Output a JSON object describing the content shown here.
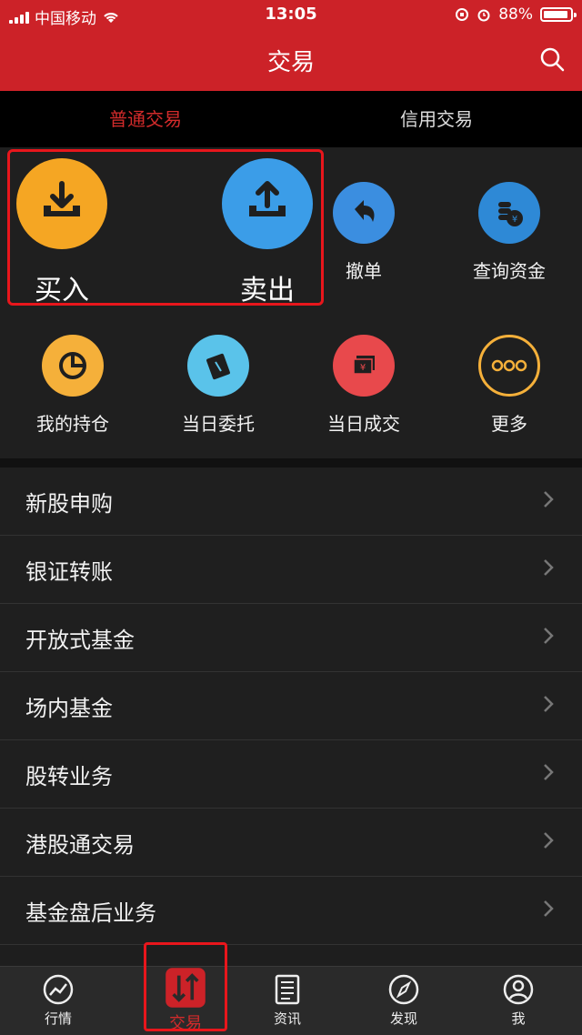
{
  "status": {
    "carrier": "中国移动",
    "time": "13:05",
    "battery": "88%"
  },
  "header": {
    "title": "交易"
  },
  "tabs": [
    {
      "label": "普通交易",
      "active": true
    },
    {
      "label": "信用交易",
      "active": false
    }
  ],
  "grid": {
    "buy": "买入",
    "sell": "卖出",
    "cancel": "撤单",
    "funds": "查询资金",
    "positions": "我的持仓",
    "orders": "当日委托",
    "deals": "当日成交",
    "more": "更多"
  },
  "list": [
    "新股申购",
    "银证转账",
    "开放式基金",
    "场内基金",
    "股转业务",
    "港股通交易",
    "基金盘后业务"
  ],
  "tabbar": {
    "market": "行情",
    "trade": "交易",
    "news": "资讯",
    "discover": "发现",
    "me": "我"
  },
  "colors": {
    "accent": "#cc2228",
    "buy": "#f5a623",
    "sell": "#3b9de8",
    "cancel": "#3b8ee0",
    "funds": "#2e89d6",
    "positions": "#f5b03a",
    "orders": "#5ac3ea",
    "deals": "#e8494c",
    "more": "#f5b03a"
  }
}
